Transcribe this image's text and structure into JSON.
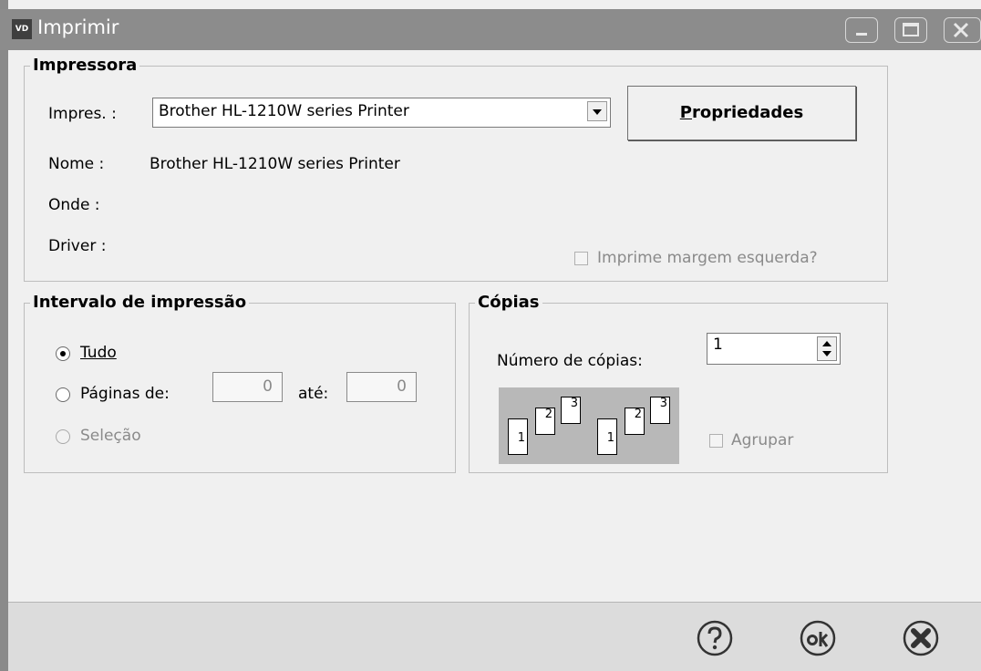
{
  "window": {
    "title": "Imprimir",
    "icon_text": "VD"
  },
  "printer_group": {
    "legend": "Impressora",
    "printer_label": "Impres. :",
    "printer_selected": "Brother HL-1210W series Printer",
    "properties_button": "Propriedades",
    "name_label": "Nome :",
    "name_value": "Brother HL-1210W series Printer",
    "where_label": "Onde :",
    "driver_label": "Driver :",
    "left_margin_checkbox": "Imprime margem esquerda?"
  },
  "range_group": {
    "legend": "Intervalo de impressão",
    "all_label": "Tudo",
    "pages_label": "Páginas de:",
    "from_value": "0",
    "to_label": "até:",
    "to_value": "0",
    "selection_label": "Seleção",
    "selected_option": "Tudo"
  },
  "copies_group": {
    "legend": "Cópias",
    "copies_label": "Número de cópias:",
    "copies_value": "1",
    "collate_label": "Agrupar",
    "collate_pages": [
      "1",
      "2",
      "3"
    ]
  },
  "footer": {
    "icons": [
      "help-icon",
      "ok-icon",
      "cancel-icon"
    ]
  }
}
